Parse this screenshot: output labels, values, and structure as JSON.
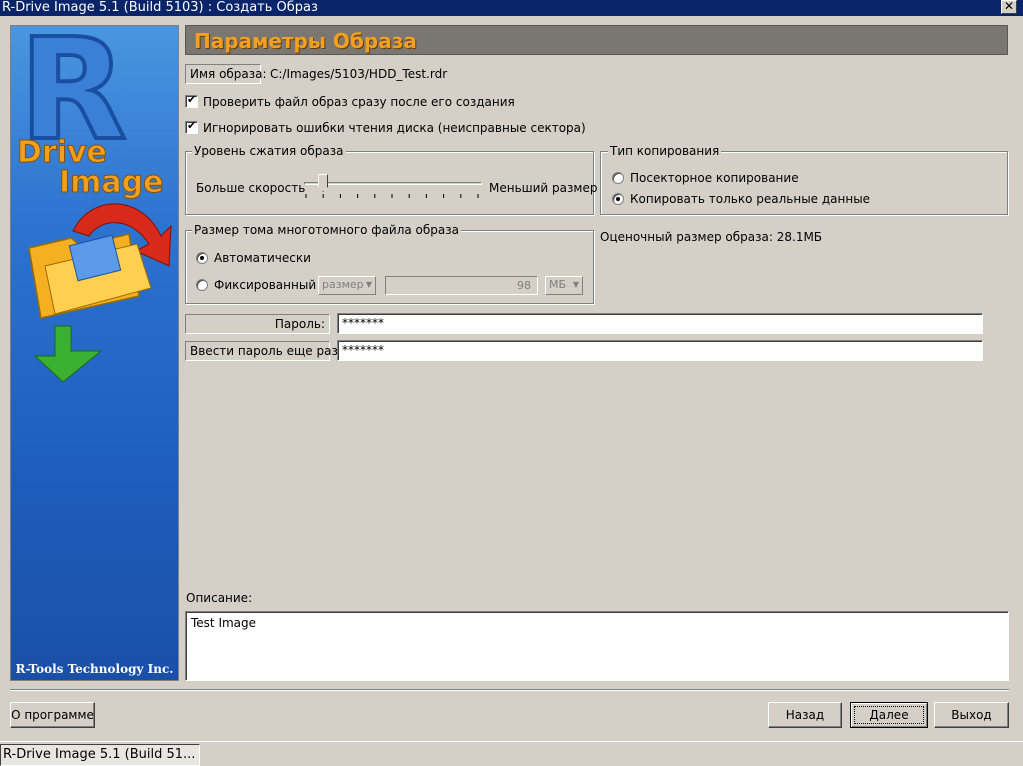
{
  "window": {
    "title": "R-Drive Image 5.1 (Build 5103) : Создать Образ",
    "close_glyph": "✕"
  },
  "banner": {
    "logo_r": "R",
    "logo_drive": "Drive",
    "logo_image": "Image",
    "company": "R-Tools Technology Inc."
  },
  "header": {
    "title": "Параметры Образа"
  },
  "image_name": {
    "label": "Имя образа:",
    "value": "C:/Images/5103/HDD_Test.rdr"
  },
  "options": {
    "verify": {
      "label": "Проверить файл образ сразу после его создания",
      "checked": true
    },
    "ignore_errors": {
      "label": "Игнорировать ошибки чтения диска (неисправные сектора)",
      "checked": true
    }
  },
  "compression": {
    "legend": "Уровень сжатия образа",
    "left_label": "Больше скорость",
    "right_label": "Меньший размер",
    "level_fraction": 0.1
  },
  "copy_type": {
    "legend": "Тип копирования",
    "sector_by_sector": "Посекторное копирование",
    "real_data_only": "Копировать только реальные данные",
    "selected": "real_data_only"
  },
  "multivolume": {
    "legend": "Размер тома многотомного файла образа",
    "auto_label": "Автоматически",
    "fixed_label": "Фиксированный",
    "size_select": "размер",
    "size_value": "98",
    "unit_select": "МБ",
    "selected": "auto"
  },
  "estimated_size": "Оценочный размер образа: 28.1МБ",
  "password": {
    "label": "Пароль:",
    "value": "*******",
    "confirm_label": "Ввести пароль еще раз:",
    "confirm_value": "*******"
  },
  "description": {
    "label": "Описание:",
    "value": "Test Image"
  },
  "buttons": {
    "about": "О программе",
    "back": "Назад",
    "next": "Далее",
    "exit": "Выход"
  },
  "taskbar": {
    "item": "R-Drive Image 5.1 (Build 51..."
  },
  "colors": {
    "titlebar": "#0a246a",
    "header_text": "#f2a020",
    "header_band": "#7a7672",
    "banner_blue": "#2d73d0"
  }
}
